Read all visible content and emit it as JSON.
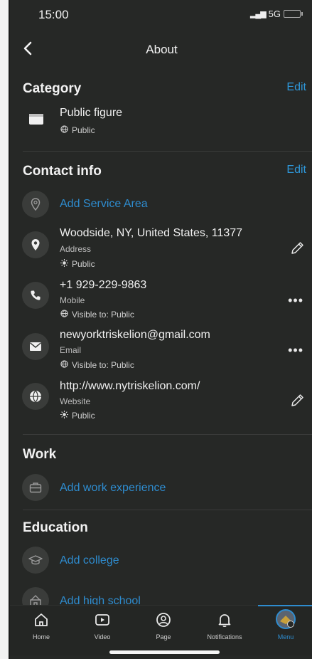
{
  "status": {
    "time": "15:00",
    "network": "5G"
  },
  "header": {
    "title": "About"
  },
  "category": {
    "heading": "Category",
    "edit": "Edit",
    "item": {
      "name": "Public figure",
      "privacy": "Public"
    }
  },
  "contact": {
    "heading": "Contact info",
    "edit": "Edit",
    "add_service_area": "Add Service Area",
    "address": {
      "value": "Woodside, NY, United States, 11377",
      "label": "Address",
      "privacy": "Public"
    },
    "phone": {
      "value": "+1 929-229-9863",
      "label": "Mobile",
      "privacy": "Visible to: Public"
    },
    "email": {
      "value": "newyorktriskelion@gmail.com",
      "label": "Email",
      "privacy": "Visible to: Public"
    },
    "website": {
      "value": "http://www.nytriskelion.com/",
      "label": "Website",
      "privacy": "Public"
    }
  },
  "work": {
    "heading": "Work",
    "add": "Add work experience"
  },
  "education": {
    "heading": "Education",
    "add_college": "Add college",
    "add_high_school": "Add high school"
  },
  "nav": [
    {
      "label": "Home",
      "icon": "home-icon"
    },
    {
      "label": "Video",
      "icon": "video-icon"
    },
    {
      "label": "Page",
      "icon": "page-icon"
    },
    {
      "label": "Notifications",
      "icon": "bell-icon"
    },
    {
      "label": "Menu",
      "icon": "profile-avatar"
    }
  ],
  "colors": {
    "accent": "#2e8ccf",
    "background": "#262826"
  }
}
